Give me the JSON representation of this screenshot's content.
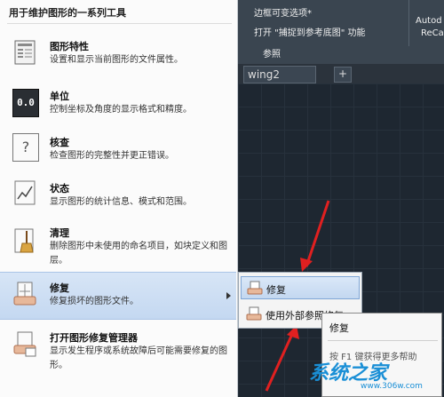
{
  "menu": {
    "header": "用于维护图形的一系列工具",
    "items": [
      {
        "title": "图形特性",
        "desc": "设置和显示当前图形的文件属性。",
        "icon": "drawing-properties-icon"
      },
      {
        "title": "单位",
        "desc": "控制坐标及角度的显示格式和精度。",
        "icon": "units-icon",
        "icon_text": "0.0"
      },
      {
        "title": "核查",
        "desc": "检查图形的完整性并更正错误。",
        "icon": "audit-icon",
        "icon_text": "?"
      },
      {
        "title": "状态",
        "desc": "显示图形的统计信息、模式和范围。",
        "icon": "status-icon"
      },
      {
        "title": "清理",
        "desc": "删除图形中未使用的命名项目，如块定义和图层。",
        "icon": "purge-icon"
      },
      {
        "title": "修复",
        "desc": "修复损坏的图形文件。",
        "icon": "recover-icon"
      },
      {
        "title": "打开图形修复管理器",
        "desc": "显示发生程序或系统故障后可能需要修复的图形。",
        "icon": "drawing-recovery-manager-icon"
      }
    ]
  },
  "ribbon": {
    "line1": "边框可变选项*",
    "line2": "打开 \"捕捉到参考底图\" 功能",
    "line3": "参照",
    "right_top": "Autod",
    "right_bottom": "ReCa",
    "tab_label": "wing2",
    "new_tab": "+"
  },
  "submenu": {
    "items": [
      "修复",
      "使用外部参照修复"
    ]
  },
  "tooltip": {
    "title": "修复",
    "help": "按 F1 键获得更多帮助"
  },
  "watermark": {
    "text": "系统之家",
    "url": "www.306w.com"
  },
  "colors": {
    "active_bg": "#c4d8f1",
    "arrow": "#e02020"
  }
}
